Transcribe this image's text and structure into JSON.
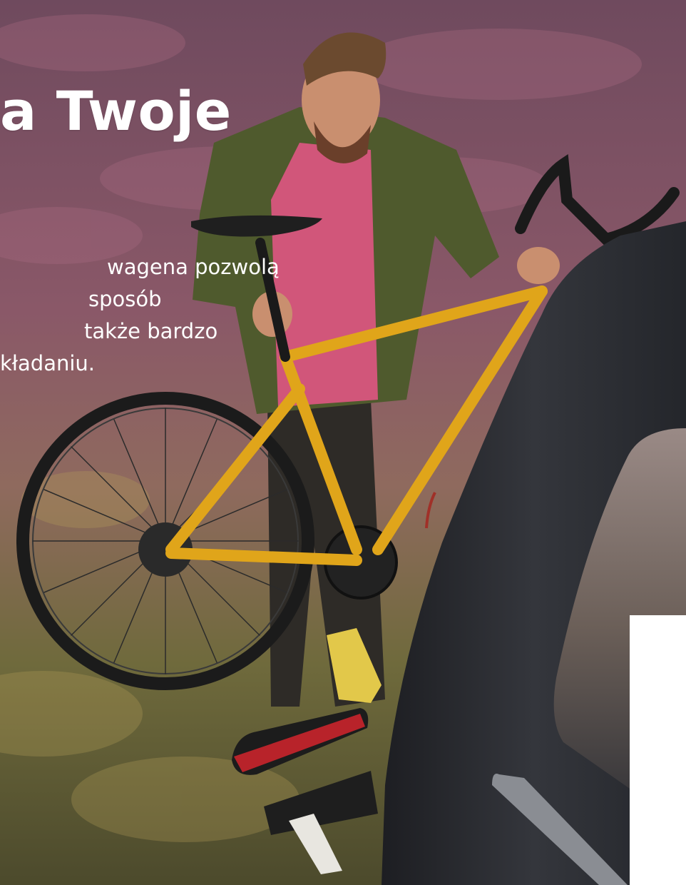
{
  "hero": {
    "title_fragment": "a Twoje",
    "text_lines": [
      "wagena pozwolą",
      "sposób",
      "także bardzo",
      "kładaniu."
    ]
  },
  "colors": {
    "heather_top": "#7a4e64",
    "heather_mid": "#8c5a6a",
    "grass": "#6f6a3c",
    "bike_frame": "#e0a51a",
    "car_body": "#2a2c31",
    "shirt": "#d1567a",
    "jacket": "#4f5a2d"
  },
  "icons": [
    "bicycle-illustration",
    "car-illustration",
    "bike-carrier-illustration"
  ]
}
